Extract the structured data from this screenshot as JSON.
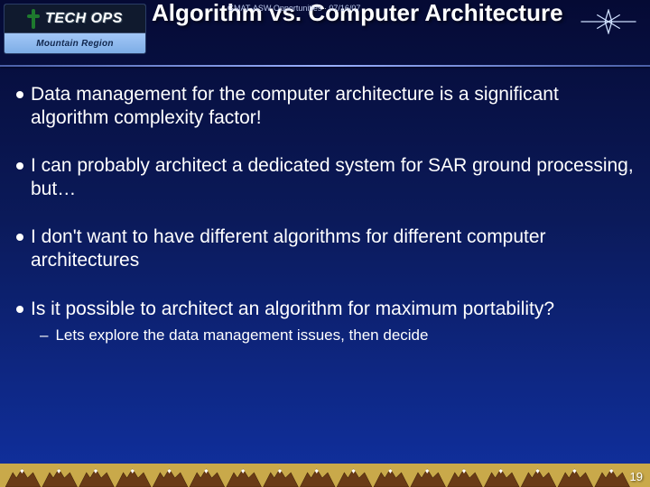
{
  "header": {
    "logo_top": "TECH OPS",
    "logo_bottom": "Mountain Region",
    "watermark": "GMAT-ASW Opportunities · 07/16/07",
    "title": "Algorithm vs. Computer Architecture"
  },
  "bullets": [
    {
      "text": "Data management for the computer architecture is a significant algorithm complexity factor!",
      "sub": []
    },
    {
      "text": "I can probably architect a dedicated system for SAR ground processing, but…",
      "sub": []
    },
    {
      "text": "I don't want to have different algorithms for different computer architectures",
      "sub": []
    },
    {
      "text": "Is it possible to architect an algorithm for maximum portability?",
      "sub": [
        "Lets explore the data management issues, then decide"
      ]
    }
  ],
  "page_number": "19"
}
